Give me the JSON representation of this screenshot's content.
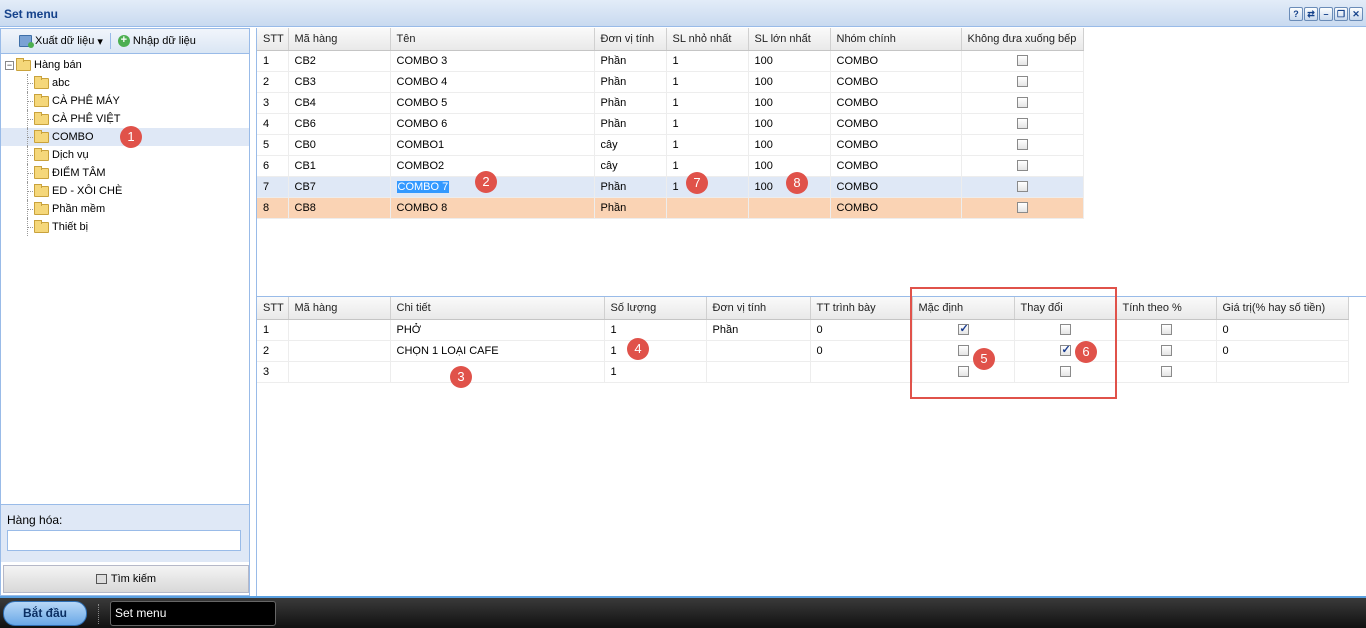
{
  "window": {
    "title": "Set menu",
    "buttons": [
      "?",
      "⇄",
      "–",
      "❐",
      "✕"
    ]
  },
  "toolbar": {
    "export_label": "Xuất dữ liệu",
    "import_label": "Nhập dữ liệu"
  },
  "tree": {
    "root": "Hàng bán",
    "items": [
      "abc",
      "CÀ PHÊ MÁY",
      "CÀ PHÊ VIỆT",
      "COMBO",
      "Dịch vụ",
      "ĐIỂM TÂM",
      "ED - XÔI CHÈ",
      "Phần mềm",
      "Thiết bị"
    ],
    "selected_index": 3
  },
  "search": {
    "label": "Hàng hóa:",
    "value": "",
    "button_label": "Tìm kiếm"
  },
  "top_grid": {
    "columns": [
      "STT",
      "Mã hàng",
      "Tên",
      "Đơn vị tính",
      "SL nhỏ nhất",
      "SL lớn nhất",
      "Nhóm chính",
      "Không đưa xuống bếp"
    ],
    "rows": [
      [
        "1",
        "CB2",
        "COMBO 3",
        "Phần",
        "1",
        "100",
        "COMBO"
      ],
      [
        "2",
        "CB3",
        "COMBO 4",
        "Phần",
        "1",
        "100",
        "COMBO"
      ],
      [
        "3",
        "CB4",
        "COMBO 5",
        "Phần",
        "1",
        "100",
        "COMBO"
      ],
      [
        "4",
        "CB6",
        "COMBO 6",
        "Phần",
        "1",
        "100",
        "COMBO"
      ],
      [
        "5",
        "CB0",
        "COMBO1",
        "cây",
        "1",
        "100",
        "COMBO"
      ],
      [
        "6",
        "CB1",
        "COMBO2",
        "cây",
        "1",
        "100",
        "COMBO"
      ],
      [
        "7",
        "CB7",
        "COMBO 7",
        "Phần",
        "1",
        "100",
        "COMBO"
      ],
      [
        "8",
        "CB8",
        "COMBO 8",
        "Phần",
        "",
        "",
        "COMBO"
      ]
    ],
    "selected_row": 6,
    "editing_row": 7
  },
  "bottom_grid": {
    "columns": [
      "STT",
      "Mã hàng",
      "Chi tiết",
      "Số lượng",
      "Đơn vị tính",
      "TT trình bày",
      "Mặc định",
      "Thay đổi",
      "Tính theo %",
      "Giá trị(% hay số tiền)"
    ],
    "rows": [
      {
        "stt": "1",
        "ma": "",
        "chitiet": "PHỞ",
        "soluong": "1",
        "dvt": "Phần",
        "tt": "0",
        "macdinh": true,
        "thaydoi": false,
        "tinhtheo": false,
        "giatri": "0"
      },
      {
        "stt": "2",
        "ma": "",
        "chitiet": "CHỌN 1 LOẠI CAFE",
        "soluong": "1",
        "dvt": "",
        "tt": "0",
        "macdinh": false,
        "thaydoi": true,
        "tinhtheo": false,
        "giatri": "0"
      },
      {
        "stt": "3",
        "ma": "",
        "chitiet": "",
        "soluong": "1",
        "dvt": "",
        "tt": "",
        "macdinh": false,
        "thaydoi": false,
        "tinhtheo": false,
        "giatri": ""
      }
    ]
  },
  "annotations": [
    "1",
    "2",
    "3",
    "4",
    "5",
    "6",
    "7",
    "8"
  ],
  "taskbar": {
    "start_label": "Bắt đầu",
    "task_label": "Set menu"
  },
  "colors": {
    "accent": "#15428b",
    "selected": "#dfe8f6",
    "editing": "#fad3b4",
    "badge": "#e0524a"
  }
}
